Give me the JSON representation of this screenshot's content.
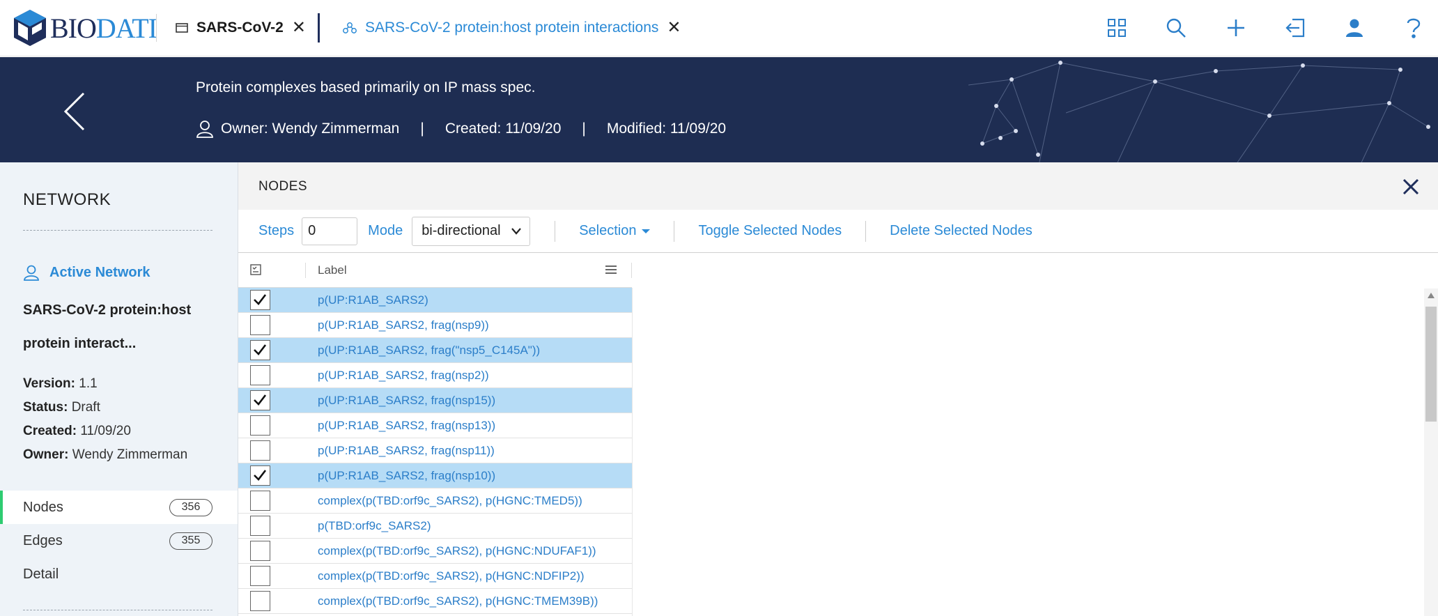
{
  "topbar": {
    "logo_text_a": "BIO",
    "logo_text_b": "DATI",
    "tabs": [
      {
        "label": "SARS-CoV-2",
        "icon": "document-icon"
      },
      {
        "label": "SARS-CoV-2 protein:host protein interactions",
        "icon": "network-icon"
      }
    ],
    "icons": [
      "grid-icon",
      "search-icon",
      "plus-icon",
      "import-icon",
      "user-icon",
      "help-icon"
    ]
  },
  "banner": {
    "description": "Protein complexes based primarily on IP mass spec.",
    "owner": "Owner: Wendy Zimmerman",
    "separator": "|",
    "created": "Created: 11/09/20",
    "modified": "Modified: 11/09/20"
  },
  "sidebar": {
    "title": "NETWORK",
    "active_label": "Active Network",
    "network_name": "SARS-CoV-2 protein:host protein interact...",
    "version_key": "Version:",
    "version_val": "1.1",
    "status_key": "Status:",
    "status_val": "Draft",
    "created_key": "Created:",
    "created_val": "11/09/20",
    "owner_key": "Owner:",
    "owner_val": "Wendy Zimmerman",
    "items": [
      {
        "label": "Nodes",
        "count": "356"
      },
      {
        "label": "Edges",
        "count": "355"
      },
      {
        "label": "Detail"
      }
    ]
  },
  "panel": {
    "title": "NODES",
    "toolbar": {
      "steps_label": "Steps",
      "steps_value": "0",
      "mode_label": "Mode",
      "mode_value": "bi-directional",
      "selection_label": "Selection",
      "toggle_label": "Toggle Selected Nodes",
      "delete_label": "Delete Selected Nodes"
    },
    "grid": {
      "column_label": "Label",
      "rows": [
        {
          "label": "p(UP:R1AB_SARS2)",
          "checked": true
        },
        {
          "label": "p(UP:R1AB_SARS2, frag(nsp9))",
          "checked": false
        },
        {
          "label": "p(UP:R1AB_SARS2, frag(\"nsp5_C145A\"))",
          "checked": true
        },
        {
          "label": "p(UP:R1AB_SARS2, frag(nsp2))",
          "checked": false
        },
        {
          "label": "p(UP:R1AB_SARS2, frag(nsp15))",
          "checked": true
        },
        {
          "label": "p(UP:R1AB_SARS2, frag(nsp13))",
          "checked": false
        },
        {
          "label": "p(UP:R1AB_SARS2, frag(nsp11))",
          "checked": false
        },
        {
          "label": "p(UP:R1AB_SARS2, frag(nsp10))",
          "checked": true
        },
        {
          "label": "complex(p(TBD:orf9c_SARS2), p(HGNC:TMED5))",
          "checked": false
        },
        {
          "label": "p(TBD:orf9c_SARS2)",
          "checked": false
        },
        {
          "label": "complex(p(TBD:orf9c_SARS2), p(HGNC:NDUFAF1))",
          "checked": false
        },
        {
          "label": "complex(p(TBD:orf9c_SARS2), p(HGNC:NDFIP2))",
          "checked": false
        },
        {
          "label": "complex(p(TBD:orf9c_SARS2), p(HGNC:TMEM39B))",
          "checked": false
        }
      ]
    }
  },
  "colors": {
    "brand_navy": "#1e2d52",
    "accent_blue": "#2b8ad6",
    "row_selected": "#b6dcf6",
    "active_green": "#2ecc71"
  }
}
